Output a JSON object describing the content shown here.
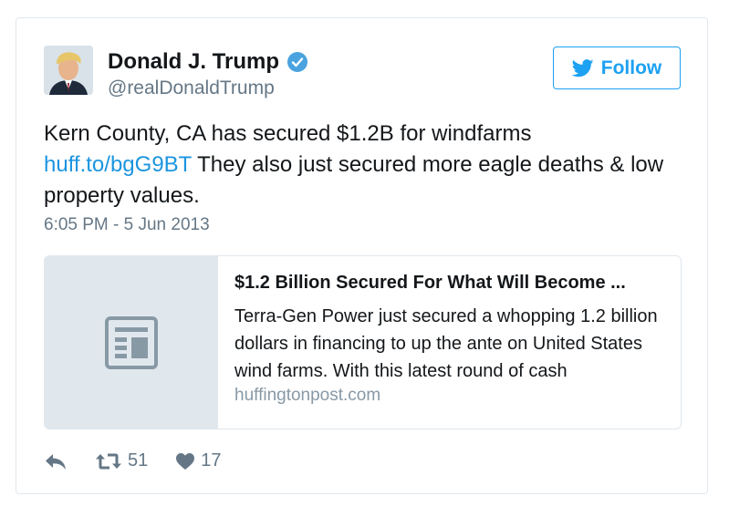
{
  "author": {
    "name": "Donald J. Trump",
    "handle": "@realDonaldTrump",
    "verified": true
  },
  "follow_button": {
    "label": "Follow"
  },
  "tweet": {
    "text_before_link": "Kern County, CA has secured $1.2B for windfarms",
    "link_text": "huff.to/bgG9BT",
    "text_after_link": " They also just secured more eagle deaths & low property values.",
    "timestamp": "6:05 PM - 5 Jun 2013"
  },
  "card": {
    "title": "$1.2 Billion Secured For What Will Become ...",
    "description": "Terra-Gen Power just secured a whopping 1.2 billion dollars in financing to up the ante on United States wind farms. With this latest round of cash",
    "domain": "huffingtonpost.com",
    "media_icon": "news-article-icon"
  },
  "actions": {
    "reply_icon": "reply-icon",
    "retweet_icon": "retweet-icon",
    "retweet_count": "51",
    "like_icon": "heart-icon",
    "like_count": "17"
  },
  "colors": {
    "link": "#1b95e0",
    "accent": "#1da1f2",
    "secondary_text": "#657786",
    "card_media_bg": "#e1e8ed"
  }
}
